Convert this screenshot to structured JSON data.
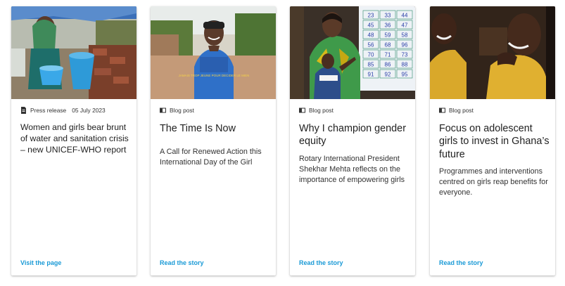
{
  "cards": [
    {
      "type": "Press release",
      "date": "05 July 2023",
      "title": "Women and girls bear brunt of water and sanitation crisis – new UNICEF-WHO report",
      "description": "",
      "cta": "Visit the page"
    },
    {
      "type": "Blog post",
      "title": "The Time Is Now",
      "description": "A Call for Renewed Action this International Day of the Girl",
      "cta": "Read the story",
      "shirt_text": "JAMAIS TROP JEUNE POUR DECIDER LE MIEN"
    },
    {
      "type": "Blog post",
      "title": "Why I champion gender equity",
      "description": "Rotary International President Shekhar Mehta reflects on the importance of empowering girls",
      "cta": "Read the story",
      "board_numbers": [
        "23",
        "33",
        "44",
        "45",
        "36",
        "47",
        "48",
        "59",
        "58",
        "56",
        "68",
        "96",
        "70",
        "71",
        "73",
        "85",
        "86",
        "88",
        "91",
        "92",
        "95"
      ]
    },
    {
      "type": "Blog post",
      "title": "Focus on adolescent girls to invest in Ghana’s future",
      "description": "Programmes and interventions centred on girls reap benefits for everyone.",
      "cta": "Read the story"
    }
  ],
  "colors": {
    "link": "#1a9ad6",
    "text": "#222222"
  }
}
